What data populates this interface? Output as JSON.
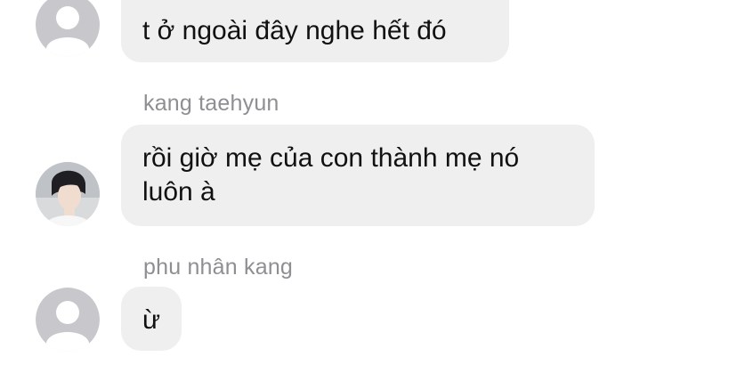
{
  "messages": [
    {
      "sender": "",
      "text": "t ở ngoài đây nghe hết đó",
      "avatar": "default-avatar-icon"
    },
    {
      "sender": "kang taehyun",
      "text": "rồi giờ mẹ của con thành mẹ nó\nluôn à",
      "avatar": "profile-photo"
    },
    {
      "sender": "phu nhân kang",
      "text": "ừ",
      "avatar": "default-avatar-icon"
    }
  ],
  "colors": {
    "bubble_bg": "#efefef",
    "sender_text": "#8e8e93",
    "message_text": "#111111",
    "default_avatar_bg": "#c7c7cc"
  }
}
